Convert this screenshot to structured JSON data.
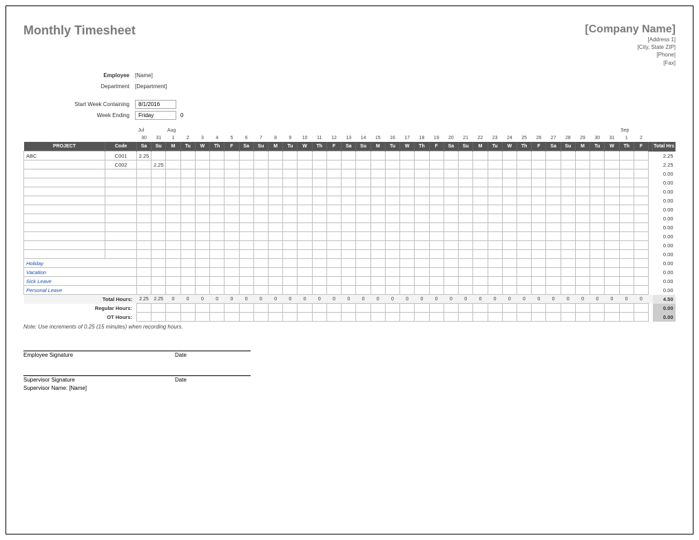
{
  "title": "Monthly Timesheet",
  "company": {
    "name": "[Company Name]",
    "address1": "[Address 1]",
    "address2": "[City, State ZIP]",
    "phone": "[Phone]",
    "fax": "[Fax]"
  },
  "info": {
    "employee_label": "Employee",
    "employee_value": "[Name]",
    "department_label": "Department",
    "department_value": "[Department]",
    "start_week_label": "Start Week Containing",
    "start_week_value": "8/1/2016",
    "week_ending_label": "Week Ending",
    "week_ending_value": "Friday",
    "week_ending_offset": "0"
  },
  "months": [
    "Jul",
    "",
    "Aug",
    "",
    "",
    "",
    "",
    "",
    "",
    "",
    "",
    "",
    "",
    "",
    "",
    "",
    "",
    "",
    "",
    "",
    "",
    "",
    "",
    "",
    "",
    "",
    "",
    "",
    "",
    "",
    "",
    "",
    "",
    "Sep",
    ""
  ],
  "dates": [
    "30",
    "31",
    "1",
    "2",
    "3",
    "4",
    "5",
    "6",
    "7",
    "8",
    "9",
    "10",
    "11",
    "12",
    "13",
    "14",
    "15",
    "16",
    "17",
    "18",
    "19",
    "20",
    "21",
    "22",
    "23",
    "24",
    "25",
    "26",
    "27",
    "28",
    "29",
    "30",
    "31",
    "1",
    "2"
  ],
  "days": [
    "Sa",
    "Su",
    "M",
    "Tu",
    "W",
    "Th",
    "F",
    "Sa",
    "Su",
    "M",
    "Tu",
    "W",
    "Th",
    "F",
    "Sa",
    "Su",
    "M",
    "Tu",
    "W",
    "Th",
    "F",
    "Sa",
    "Su",
    "M",
    "Tu",
    "W",
    "Th",
    "F",
    "Sa",
    "Su",
    "M",
    "Tu",
    "W",
    "Th",
    "F"
  ],
  "columns": {
    "project": "PROJECT",
    "code": "Code",
    "total": "Total Hrs"
  },
  "rows": [
    {
      "project": "ABC",
      "code": "C001",
      "hours": [
        "2.25",
        "",
        "",
        "",
        "",
        "",
        "",
        "",
        "",
        "",
        "",
        "",
        "",
        "",
        "",
        "",
        "",
        "",
        "",
        "",
        "",
        "",
        "",
        "",
        "",
        "",
        "",
        "",
        "",
        "",
        "",
        "",
        "",
        "",
        ""
      ],
      "total": "2.25"
    },
    {
      "project": "",
      "code": "C002",
      "hours": [
        "",
        "2.25",
        "",
        "",
        "",
        "",
        "",
        "",
        "",
        "",
        "",
        "",
        "",
        "",
        "",
        "",
        "",
        "",
        "",
        "",
        "",
        "",
        "",
        "",
        "",
        "",
        "",
        "",
        "",
        "",
        "",
        "",
        "",
        "",
        ""
      ],
      "total": "2.25"
    },
    {
      "project": "",
      "code": "",
      "hours": [
        "",
        "",
        "",
        "",
        "",
        "",
        "",
        "",
        "",
        "",
        "",
        "",
        "",
        "",
        "",
        "",
        "",
        "",
        "",
        "",
        "",
        "",
        "",
        "",
        "",
        "",
        "",
        "",
        "",
        "",
        "",
        "",
        "",
        "",
        ""
      ],
      "total": "0.00"
    },
    {
      "project": "",
      "code": "",
      "hours": [
        "",
        "",
        "",
        "",
        "",
        "",
        "",
        "",
        "",
        "",
        "",
        "",
        "",
        "",
        "",
        "",
        "",
        "",
        "",
        "",
        "",
        "",
        "",
        "",
        "",
        "",
        "",
        "",
        "",
        "",
        "",
        "",
        "",
        "",
        ""
      ],
      "total": "0.00"
    },
    {
      "project": "",
      "code": "",
      "hours": [
        "",
        "",
        "",
        "",
        "",
        "",
        "",
        "",
        "",
        "",
        "",
        "",
        "",
        "",
        "",
        "",
        "",
        "",
        "",
        "",
        "",
        "",
        "",
        "",
        "",
        "",
        "",
        "",
        "",
        "",
        "",
        "",
        "",
        "",
        ""
      ],
      "total": "0.00"
    },
    {
      "project": "",
      "code": "",
      "hours": [
        "",
        "",
        "",
        "",
        "",
        "",
        "",
        "",
        "",
        "",
        "",
        "",
        "",
        "",
        "",
        "",
        "",
        "",
        "",
        "",
        "",
        "",
        "",
        "",
        "",
        "",
        "",
        "",
        "",
        "",
        "",
        "",
        "",
        "",
        ""
      ],
      "total": "0.00"
    },
    {
      "project": "",
      "code": "",
      "hours": [
        "",
        "",
        "",
        "",
        "",
        "",
        "",
        "",
        "",
        "",
        "",
        "",
        "",
        "",
        "",
        "",
        "",
        "",
        "",
        "",
        "",
        "",
        "",
        "",
        "",
        "",
        "",
        "",
        "",
        "",
        "",
        "",
        "",
        "",
        ""
      ],
      "total": "0.00"
    },
    {
      "project": "",
      "code": "",
      "hours": [
        "",
        "",
        "",
        "",
        "",
        "",
        "",
        "",
        "",
        "",
        "",
        "",
        "",
        "",
        "",
        "",
        "",
        "",
        "",
        "",
        "",
        "",
        "",
        "",
        "",
        "",
        "",
        "",
        "",
        "",
        "",
        "",
        "",
        "",
        ""
      ],
      "total": "0.00"
    },
    {
      "project": "",
      "code": "",
      "hours": [
        "",
        "",
        "",
        "",
        "",
        "",
        "",
        "",
        "",
        "",
        "",
        "",
        "",
        "",
        "",
        "",
        "",
        "",
        "",
        "",
        "",
        "",
        "",
        "",
        "",
        "",
        "",
        "",
        "",
        "",
        "",
        "",
        "",
        "",
        ""
      ],
      "total": "0.00"
    },
    {
      "project": "",
      "code": "",
      "hours": [
        "",
        "",
        "",
        "",
        "",
        "",
        "",
        "",
        "",
        "",
        "",
        "",
        "",
        "",
        "",
        "",
        "",
        "",
        "",
        "",
        "",
        "",
        "",
        "",
        "",
        "",
        "",
        "",
        "",
        "",
        "",
        "",
        "",
        "",
        ""
      ],
      "total": "0.00"
    },
    {
      "project": "",
      "code": "",
      "hours": [
        "",
        "",
        "",
        "",
        "",
        "",
        "",
        "",
        "",
        "",
        "",
        "",
        "",
        "",
        "",
        "",
        "",
        "",
        "",
        "",
        "",
        "",
        "",
        "",
        "",
        "",
        "",
        "",
        "",
        "",
        "",
        "",
        "",
        "",
        ""
      ],
      "total": "0.00"
    },
    {
      "project": "",
      "code": "",
      "hours": [
        "",
        "",
        "",
        "",
        "",
        "",
        "",
        "",
        "",
        "",
        "",
        "",
        "",
        "",
        "",
        "",
        "",
        "",
        "",
        "",
        "",
        "",
        "",
        "",
        "",
        "",
        "",
        "",
        "",
        "",
        "",
        "",
        "",
        "",
        ""
      ],
      "total": "0.00"
    }
  ],
  "leave_rows": [
    {
      "project": "Holiday",
      "total": "0.00"
    },
    {
      "project": "Vacation",
      "total": "0.00"
    },
    {
      "project": "Sick Leave",
      "total": "0.00"
    },
    {
      "project": "Personal Leave",
      "total": "0.00"
    }
  ],
  "totals": {
    "total_hours_label": "Total Hours:",
    "total_hours": [
      "2.25",
      "2.25",
      "0",
      "0",
      "0",
      "0",
      "0",
      "0",
      "0",
      "0",
      "0",
      "0",
      "0",
      "0",
      "0",
      "0",
      "0",
      "0",
      "0",
      "0",
      "0",
      "0",
      "0",
      "0",
      "0",
      "0",
      "0",
      "0",
      "0",
      "0",
      "0",
      "0",
      "0",
      "0",
      "0"
    ],
    "total_hours_sum": "4.50",
    "regular_label": "Regular Hours:",
    "regular_sum": "0.00",
    "ot_label": "OT Hours:",
    "ot_sum": "0.00"
  },
  "note": "Note: Use increments of 0.25 (15 minutes) when recording hours.",
  "signatures": {
    "employee_sig": "Employee Signature",
    "date": "Date",
    "supervisor_sig": "Supervisor Signature",
    "supervisor_name_label": "Supervisor Name: [Name]"
  }
}
